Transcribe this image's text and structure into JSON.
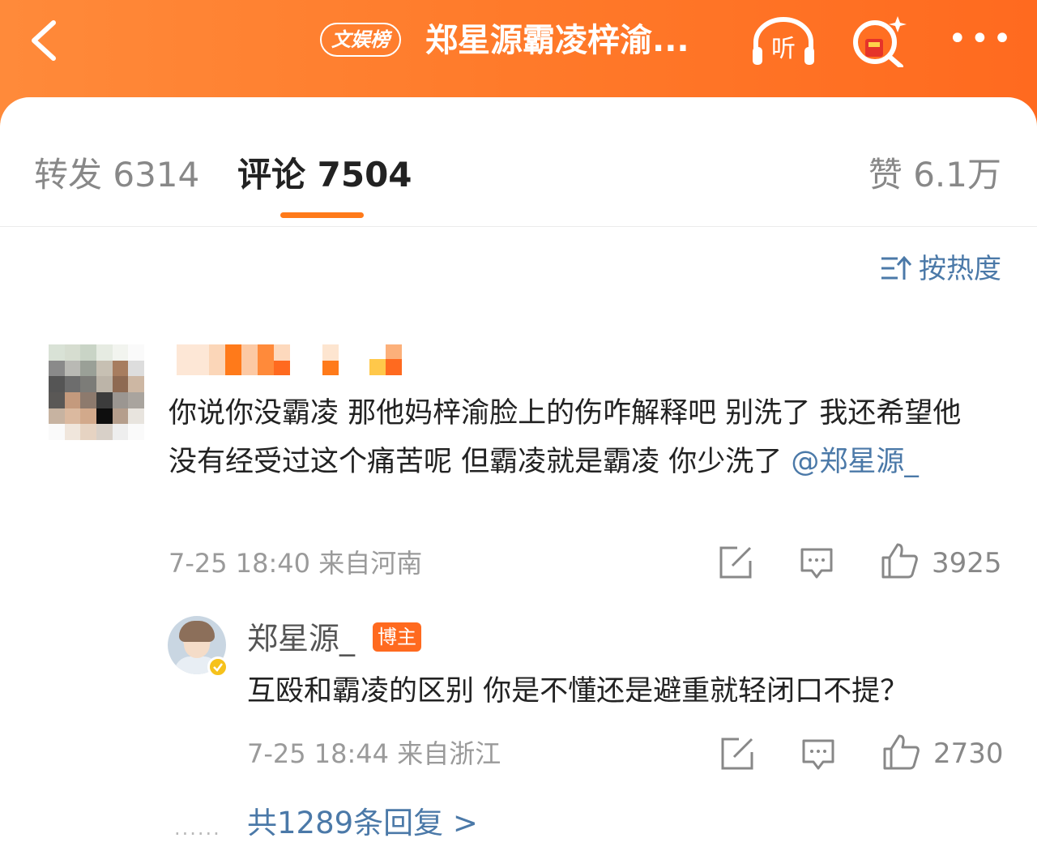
{
  "header": {
    "back_icon": "chevron-left-icon",
    "badge": "文娱榜",
    "title": "郑星源霸凌梓渝...",
    "listen_label": "听",
    "more_label": "•••",
    "accent": "#ff7a1a"
  },
  "tabs": {
    "repost": "转发 6314",
    "comment": "评论 7504",
    "likes": "赞 6.1万"
  },
  "sort": {
    "label": "按热度",
    "icon": "sort-icon"
  },
  "comment": {
    "text_before": "你说你没霸凌 那他妈梓渝脸上的伤咋解释吧 别洗了 我还希望他没有经受过这个痛苦呢 但霸凌就是霸凌 你少洗了 ",
    "mention": "@郑星源_",
    "time": "7-25 18:40",
    "location": "来自河南",
    "like_count": "3925"
  },
  "reply": {
    "name": "郑星源_",
    "badge": "博主",
    "text": "互殴和霸凌的区别 你是不懂还是避重就轻闭口不提？",
    "time": "7-25 18:44",
    "location": "来自浙江",
    "like_count": "2730"
  },
  "replies_link": {
    "dots": "......",
    "label": "共1289条回复 >"
  }
}
